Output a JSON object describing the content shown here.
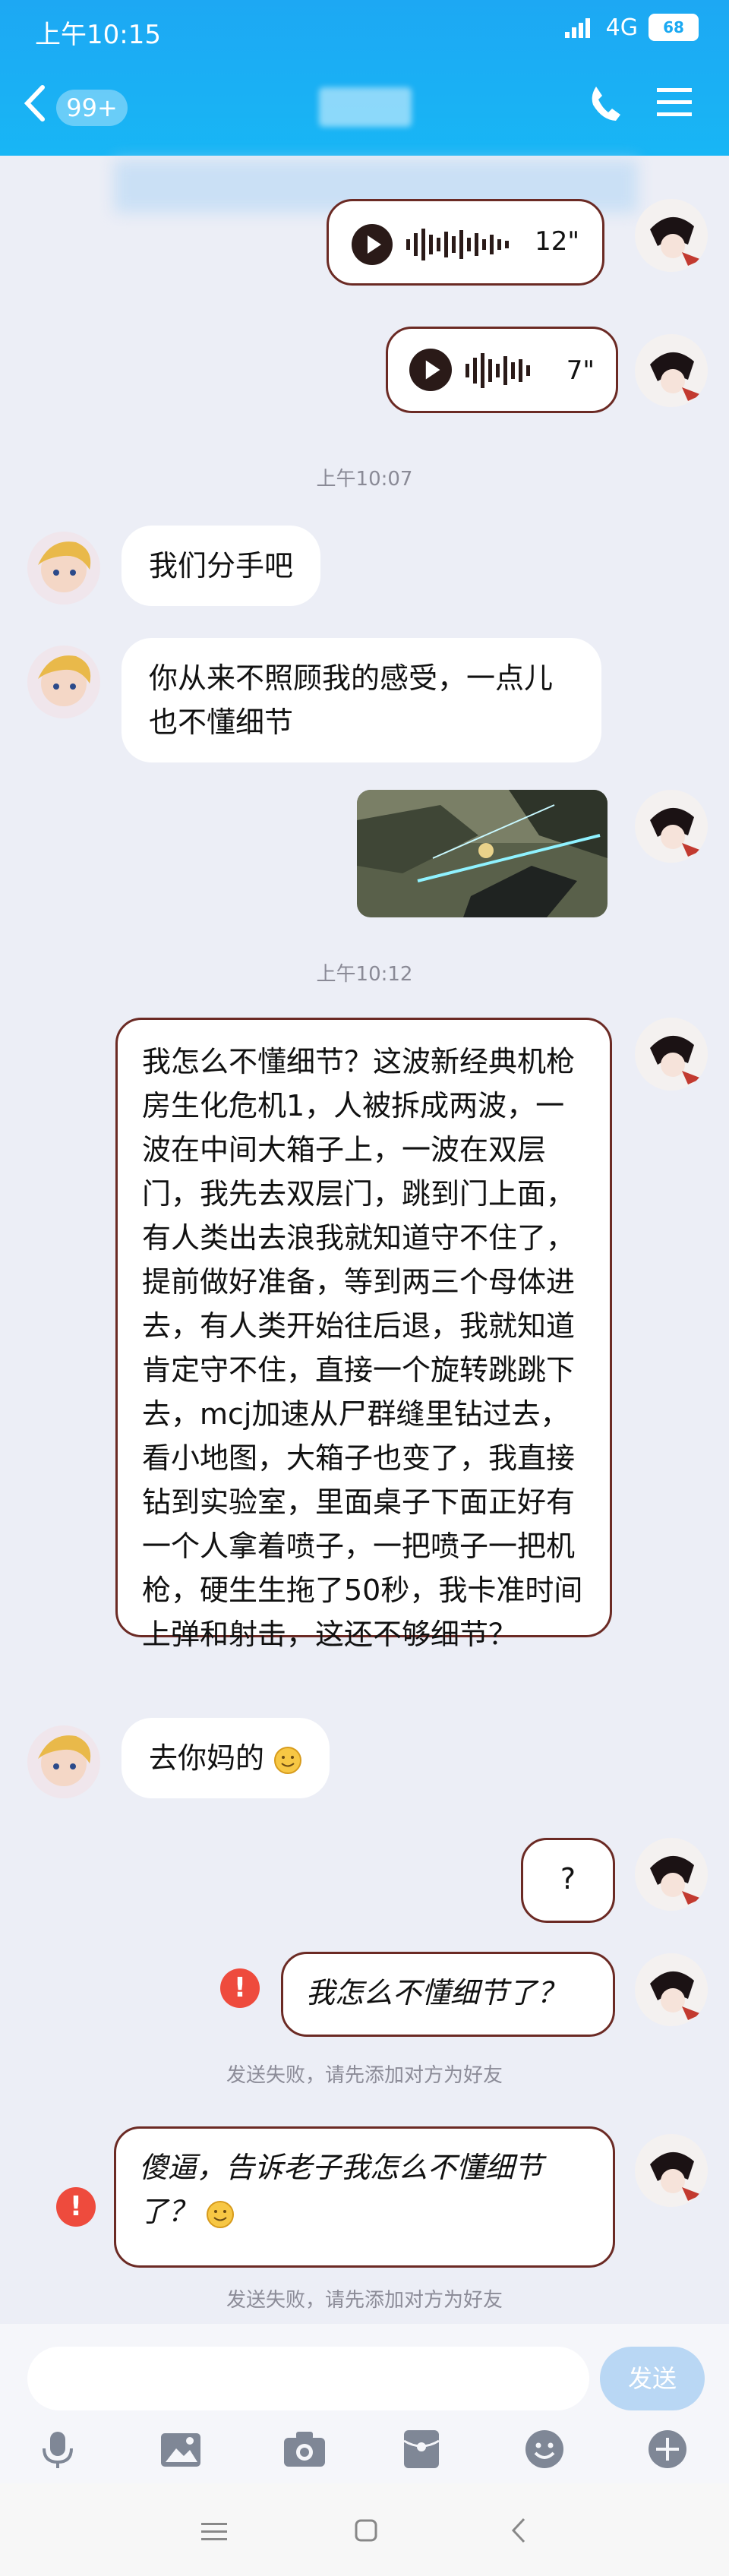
{
  "status": {
    "time": "上午10:15",
    "network": "4G",
    "battery": "68"
  },
  "header": {
    "unread_badge": "99+"
  },
  "messages": {
    "voice1_duration": "12\"",
    "voice2_duration": "7\"",
    "time1": "上午10:07",
    "left1": "我们分手吧",
    "left2": "你从来不照顾我的感受，一点儿也不懂细节",
    "time2": "上午10:12",
    "long_text": "我怎么不懂细节？这波新经典机枪房生化危机1，人被拆成两波，一波在中间大箱子上，一波在双层门，我先去双层门，跳到门上面，有人类出去浪我就知道守不住了，提前做好准备，等到两三个母体进去，有人类开始往后退，我就知道肯定守不住，直接一个旋转跳跳下去，mcj加速从尸群缝里钻过去，看小地图，大箱子也变了，我直接钻到实验室，里面桌子下面正好有一个人拿着喷子，一把喷子一把机枪，硬生生拖了50秒，我卡准时间上弹和射击，这还不够细节？",
    "left3": "去你妈的",
    "q_mark": "?",
    "fail1_text": "我怎么不懂细节了？",
    "fail1_note": "发送失败，请先添加对方为好友",
    "fail2_text": "傻逼，告诉老子我怎么不懂细节了？",
    "fail2_note": "发送失败，请先添加对方为好友"
  },
  "input": {
    "send_label": "发送"
  },
  "colors": {
    "header": "#1da8f3",
    "frame": "#6b2a24",
    "fail": "#ee4b3d",
    "background": "#eceef6"
  }
}
